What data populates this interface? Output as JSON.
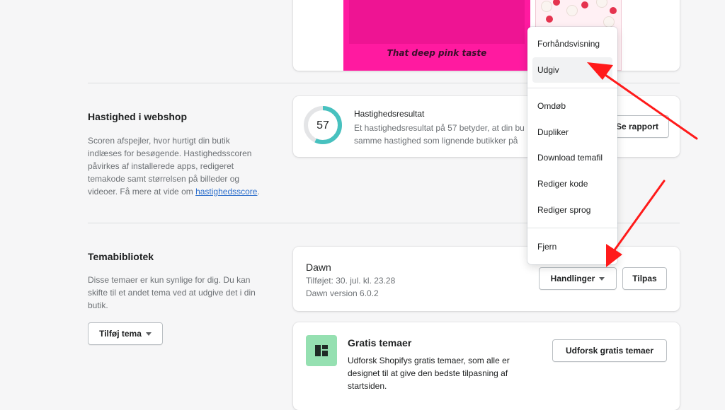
{
  "preview": {
    "tagline": "That deep pink taste"
  },
  "speed": {
    "title": "Hastighed i webshop",
    "desc_text": "Scoren afspejler, hvor hurtigt din butik indlæses for besøgende. Hastighedsscoren påvirkes af installerede apps, redigeret temakode samt størrelsen på billeder og videoer. Få mere at vide om ",
    "desc_link": "hastighedsscore",
    "desc_end": ".",
    "score": "57",
    "score_fraction": 0.57,
    "result_title": "Hastighedsresultat",
    "result_line1": "Et hastighedsresultat på 57 betyder, at din bu",
    "result_line2": "samme hastighed som lignende butikker på",
    "report_button": "Se rapport"
  },
  "library": {
    "title": "Temabibliotek",
    "desc": "Disse temaer er kun synlige for dig. Du kan skifte til et andet tema ved at udgive det i din butik.",
    "add_theme_button": "Tilføj tema"
  },
  "theme": {
    "name": "Dawn",
    "added": "Tilføjet: 30. jul. kl. 23.28",
    "version": "Dawn version 6.0.2",
    "actions_button": "Handlinger",
    "customize_button": "Tilpas"
  },
  "free_themes": {
    "title": "Gratis temaer",
    "desc_line1": "Udforsk Shopifys gratis temaer, som alle er",
    "desc_line2": "designet til at give den bedste tilpasning af",
    "desc_line3": "startsiden.",
    "button": "Udforsk gratis temaer"
  },
  "menu": {
    "preview": "Forhåndsvisning",
    "publish": "Udgiv",
    "rename": "Omdøb",
    "duplicate": "Dupliker",
    "download": "Download temafil",
    "edit_code": "Rediger kode",
    "edit_language": "Rediger sprog",
    "remove": "Fjern"
  },
  "colors": {
    "accent_teal": "#47c1bf",
    "annotation_red": "#ff1a1a",
    "free_theme_icon_bg": "#95e0b1"
  }
}
